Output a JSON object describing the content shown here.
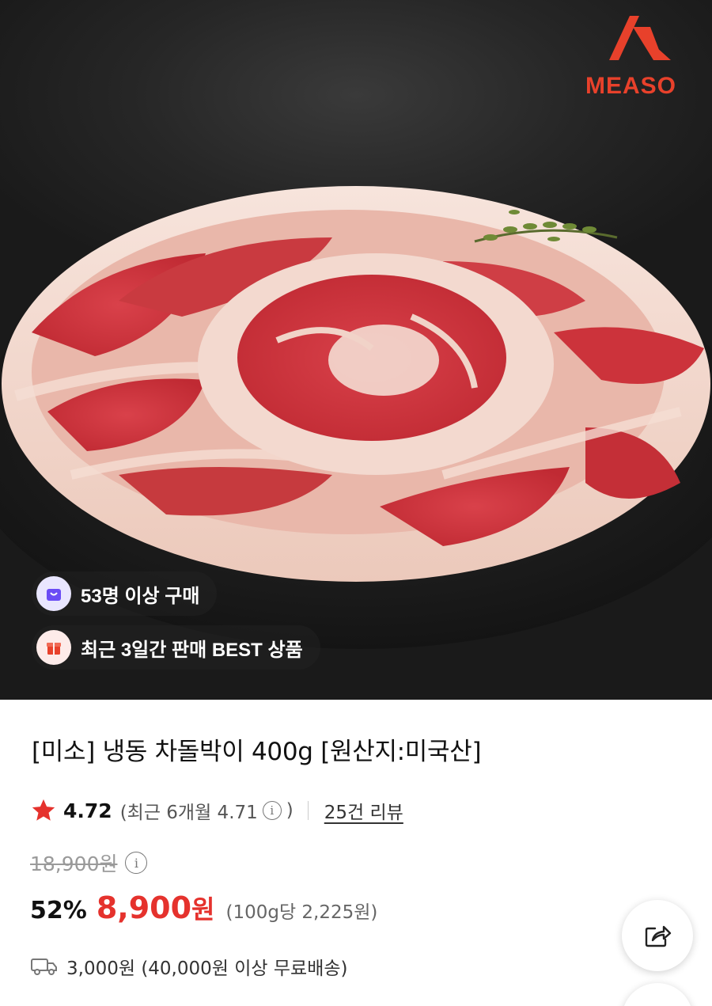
{
  "hero": {
    "brand_name": "MEASO",
    "badges": [
      {
        "icon": "shopping-bag-icon",
        "text": "53명 이상 구매",
        "icon_color": "#6a4cf5"
      },
      {
        "icon": "gift-box-icon",
        "text": "최근 3일간 판매 BEST 상품",
        "icon_color": "#e8412b"
      }
    ]
  },
  "product": {
    "title": "[미소] 냉동 차돌박이 400g [원산지:미국산]",
    "rating": {
      "score": "4.72",
      "recent": "(최근 6개월 4.71",
      "recent_close": ")",
      "reviews": "25건 리뷰"
    },
    "original_price": "18,900원",
    "discount": "52%",
    "sale_price": "8,900",
    "sale_currency": "원",
    "unit_price": "(100g당 2,225원)",
    "shipping": "3,000원 (40,000원 이상 무료배송)"
  },
  "actions": {
    "share_icon": "share-icon"
  },
  "colors": {
    "accent": "#e5322d",
    "brand": "#e8412b",
    "star": "#e5322d"
  }
}
